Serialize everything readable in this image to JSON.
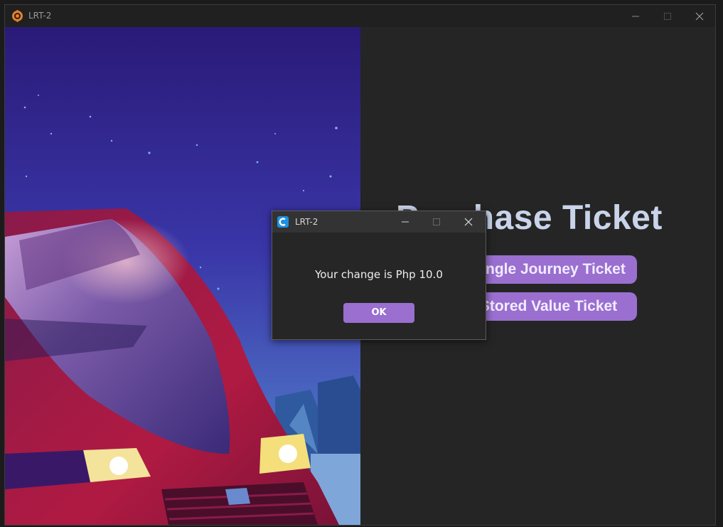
{
  "window": {
    "title": "LRT-2",
    "icon": "app-logo-icon",
    "controls": [
      "minimize-icon",
      "maximize-icon",
      "close-icon"
    ]
  },
  "main": {
    "heading": "Purchase Ticket",
    "buttons": [
      {
        "label": "Single Journey Ticket"
      },
      {
        "label": "Stored Value Ticket"
      }
    ]
  },
  "dialog": {
    "title": "LRT-2",
    "icon": "app-c-icon",
    "message": "Your change is Php 10.0",
    "ok_label": "OK"
  },
  "colors": {
    "accent": "#9a6fd0",
    "heading": "#c9d4ea",
    "background": "#252525"
  }
}
